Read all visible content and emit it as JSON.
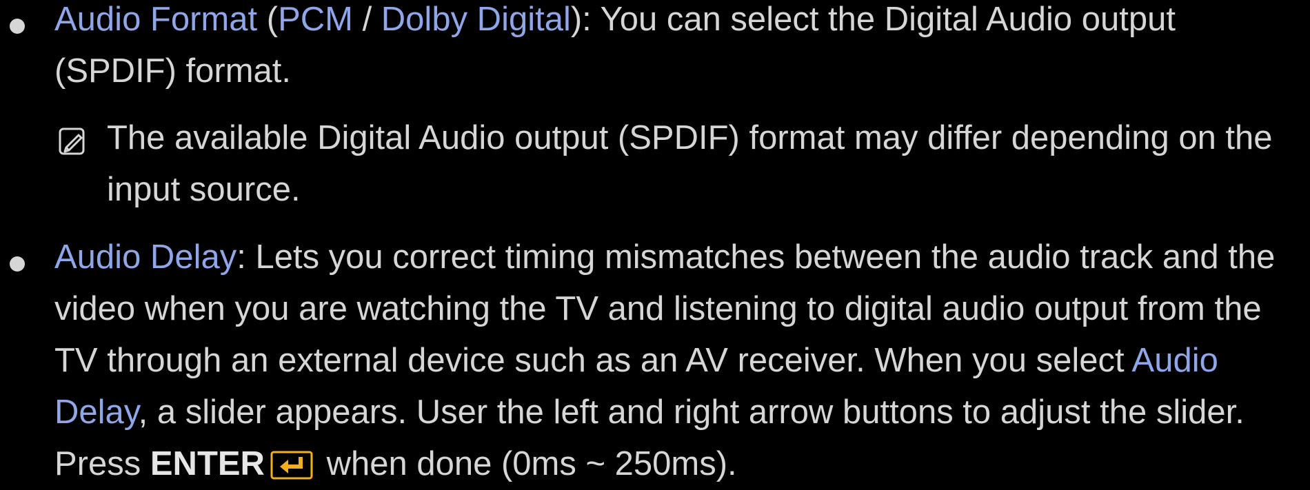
{
  "colors": {
    "background": "#000000",
    "text": "#d6d6d6",
    "highlight": "#8fa6e8",
    "enter_icon": "#f2b01e"
  },
  "items": [
    {
      "term": "Audio Format",
      "open_paren": " (",
      "option1": "PCM",
      "sep": " / ",
      "option2": "Dolby Digital",
      "rest": "): You can select the Digital Audio output (SPDIF) format."
    },
    {
      "term": "Audio Delay",
      "text1": ": Lets you correct timing mismatches between the audio track and the video when you are watching the TV and listening to digital audio output from the TV through an external device such as an AV receiver. When you select ",
      "term2": "Audio Delay",
      "text2": ", a slider appears. User the left and right arrow buttons to adjust the slider. Press ",
      "enter_label": "ENTER",
      "text3": " when done (0ms ~ 250ms)."
    }
  ],
  "note": {
    "icon": "note-icon",
    "text": "The available Digital Audio output (SPDIF) format may differ depending on the input source."
  },
  "icons": {
    "bullet": "bullet-dot",
    "note": "note-icon",
    "enter": "enter-icon"
  }
}
